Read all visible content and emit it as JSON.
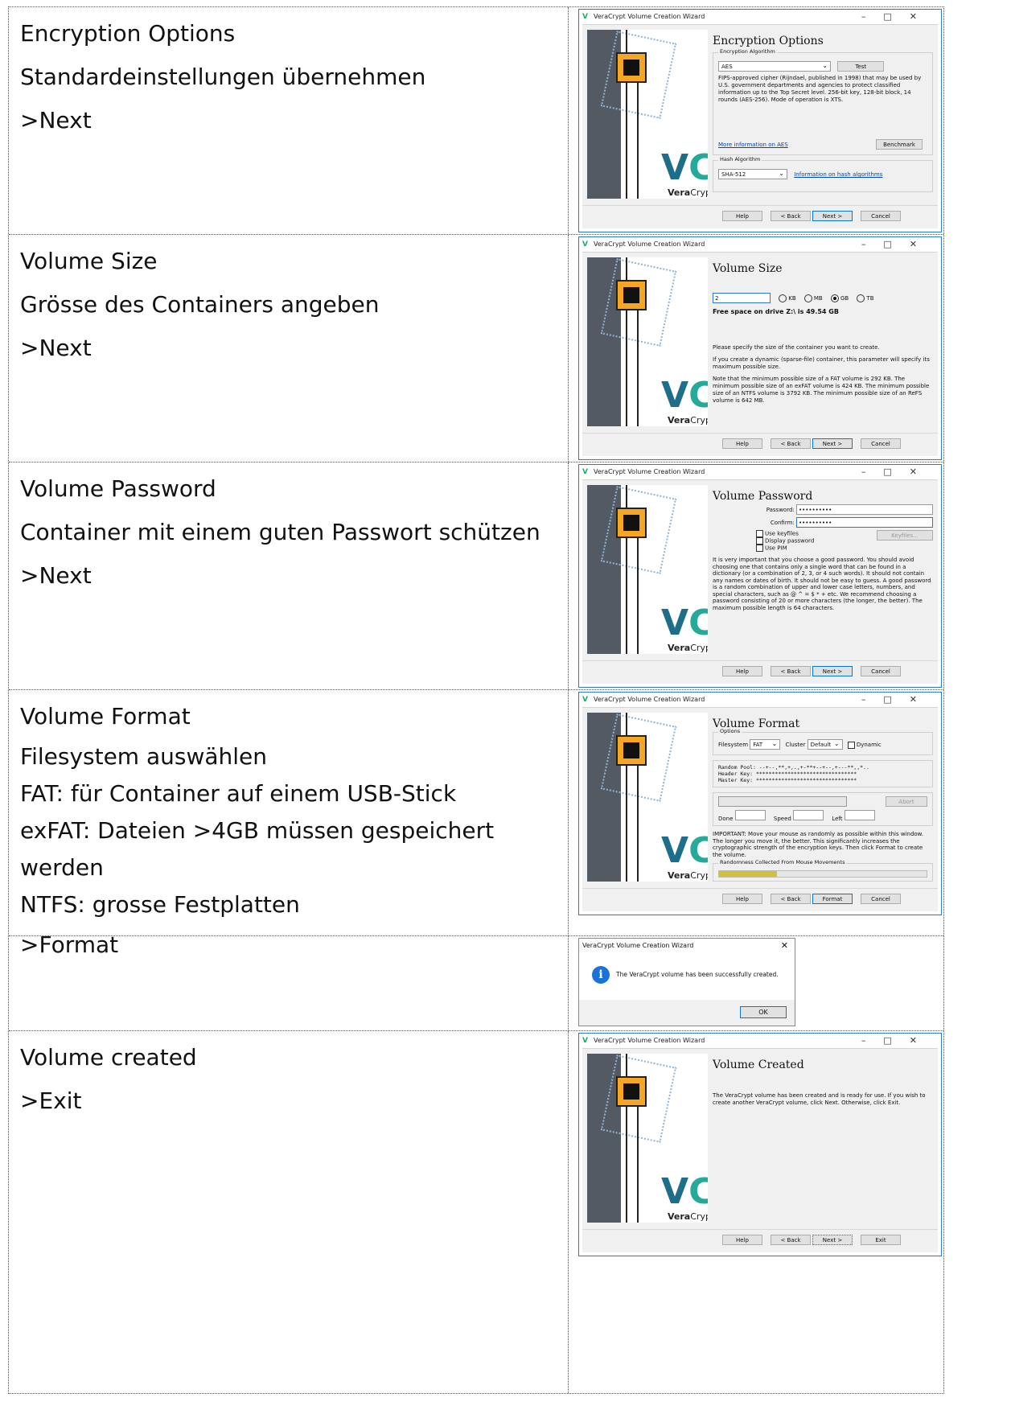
{
  "rows": [
    {
      "lines": [
        "Encryption Options",
        "Standardeinstellungen übernehmen",
        ">Next"
      ],
      "window": {
        "title": "VeraCrypt Volume Creation Wizard",
        "heading": "Encryption Options",
        "enc_group_label": "Encryption Algorithm",
        "enc_algorithm": "AES",
        "test_btn": "Test",
        "description": "FIPS-approved cipher (Rijndael, published in 1998) that may be used by U.S. government departments and agencies to protect classified information up to the Top Secret level. 256-bit key, 128-bit block, 14 rounds (AES-256). Mode of operation is XTS.",
        "more_info_link": "More information on AES",
        "benchmark_btn": "Benchmark",
        "hash_group_label": "Hash Algorithm",
        "hash_algorithm": "SHA-512",
        "hash_link": "Information on hash algorithms",
        "buttons": [
          "Help",
          "< Back",
          "Next >",
          "Cancel"
        ]
      }
    },
    {
      "lines": [
        "Volume Size",
        "Grösse des Containers angeben",
        ">Next"
      ],
      "window": {
        "title": "VeraCrypt Volume Creation Wizard",
        "heading": "Volume Size",
        "size_value": "2",
        "units": [
          "KB",
          "MB",
          "GB",
          "TB"
        ],
        "selected_unit": "GB",
        "free_space": "Free space on drive Z:\\ is 49.54 GB",
        "p1": "Please specify the size of the container you want to create.",
        "p2": "If you create a dynamic (sparse-file) container, this parameter will specify its maximum possible size.",
        "p3": "Note that the minimum possible size of a FAT volume is 292 KB. The minimum possible size of an exFAT volume is 424 KB. The minimum possible size of an NTFS volume is 3792 KB. The minimum possible size of an ReFS volume is 642 MB.",
        "buttons": [
          "Help",
          "< Back",
          "Next >",
          "Cancel"
        ]
      }
    },
    {
      "lines": [
        "Volume Password",
        "Container mit einem guten Passwort schützen",
        ">Next"
      ],
      "window": {
        "title": "VeraCrypt Volume Creation Wizard",
        "heading": "Volume Password",
        "password_label": "Password:",
        "password_value": "••••••••••",
        "confirm_label": "Confirm:",
        "confirm_value": "••••••••••",
        "use_keyfiles": "Use keyfiles",
        "display_password": "Display password",
        "use_pim": "Use PIM",
        "keyfiles_btn": "Keyfiles...",
        "info": "It is very important that you choose a good password. You should avoid choosing one that contains only a single word that can be found in a dictionary (or a combination of 2, 3, or 4 such words). It should not contain any names or dates of birth. It should not be easy to guess. A good password is a random combination of upper and lower case letters, numbers, and special characters, such as @ ^ = $ * + etc. We recommend choosing a password consisting of 20 or more characters (the longer, the better). The maximum possible length is 64 characters.",
        "buttons": [
          "Help",
          "< Back",
          "Next >",
          "Cancel"
        ]
      }
    },
    {
      "lines": [
        "Volume Format",
        "Filesystem auswählen",
        "FAT:     für Container auf einem USB-Stick",
        "exFAT:             Dateien >4GB müssen gespeichert werden",
        "NTFS:  grosse Festplatten",
        ">Format"
      ],
      "window": {
        "title": "VeraCrypt Volume Creation Wizard",
        "heading": "Volume Format",
        "options_label": "Options",
        "filesystem_label": "Filesystem",
        "filesystem_value": "FAT",
        "cluster_label": "Cluster",
        "cluster_value": "Default",
        "dynamic_label": "Dynamic",
        "random_pool_label": "Random Pool:",
        "random_pool_value": "--+--,**,+,.,+-**+--+--,+---**,,*..",
        "header_key_label": "Header Key:",
        "header_key_value": "********************************",
        "master_key_label": "Master Key:",
        "master_key_value": "********************************",
        "abort_btn": "Abort",
        "done_label": "Done",
        "speed_label": "Speed",
        "left_label": "Left",
        "important": "IMPORTANT: Move your mouse as randomly as possible within this window. The longer you move it, the better. This significantly increases the cryptographic strength of the encryption keys. Then click Format to create the volume.",
        "randomness_label": "Randomness Collected From Mouse Movements",
        "randomness_fraction": 0.28,
        "buttons": [
          "Help",
          "< Back",
          "Format",
          "Cancel"
        ]
      }
    },
    {
      "lines": [],
      "message": {
        "title": "VeraCrypt Volume Creation Wizard",
        "text": "The VeraCrypt volume has been successfully created.",
        "ok": "OK"
      }
    },
    {
      "lines": [
        "Volume created",
        ">Exit"
      ],
      "window": {
        "title": "VeraCrypt Volume Creation Wizard",
        "heading": "Volume Created",
        "text": "The VeraCrypt volume has been created and is ready for use. If you wish to create another VeraCrypt volume, click Next. Otherwise, click Exit.",
        "buttons": [
          "Help",
          "< Back",
          "Next >",
          "Exit"
        ]
      }
    }
  ],
  "logo": {
    "brand_bold": "Vera",
    "brand_rest": "Crypt"
  }
}
